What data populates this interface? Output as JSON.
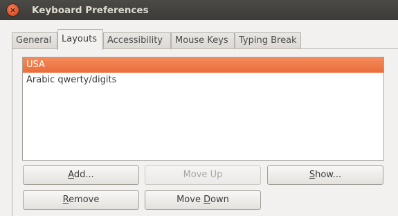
{
  "window": {
    "title": "Keyboard Preferences",
    "close_glyph": "×"
  },
  "tabs": [
    {
      "label": "General",
      "active": false
    },
    {
      "label": "Layouts",
      "active": true
    },
    {
      "label": "Accessibility",
      "active": false
    },
    {
      "label": "Mouse Keys",
      "active": false
    },
    {
      "label": "Typing Break",
      "active": false
    }
  ],
  "layouts": {
    "items": [
      {
        "label": "USA",
        "selected": true
      },
      {
        "label": "Arabic qwerty/digits",
        "selected": false
      }
    ],
    "selection_color": "#ea6d3a"
  },
  "buttons": {
    "add": {
      "mnemonic": "A",
      "rest": "dd..."
    },
    "move_up": {
      "label": "Move Up",
      "enabled": false
    },
    "show": {
      "mnemonic": "S",
      "rest": "how..."
    },
    "remove": {
      "mnemonic": "R",
      "rest": "emove"
    },
    "move_down": {
      "before": "Move ",
      "mnemonic": "D",
      "rest": "own"
    }
  }
}
